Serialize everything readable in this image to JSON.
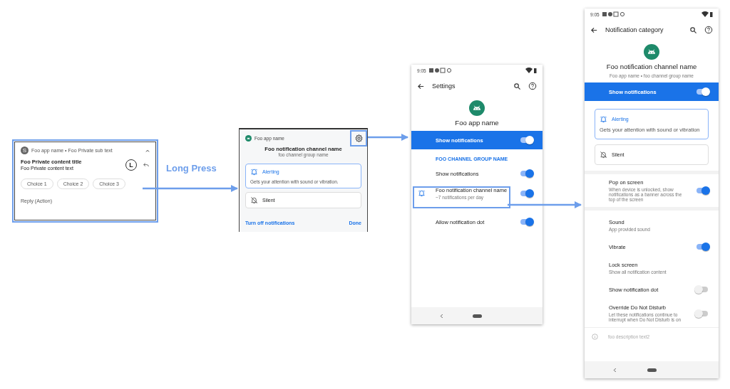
{
  "notification": {
    "app_badge": "S",
    "header": "Foo app name • Foo Private sub text",
    "title": "Foo Private content title",
    "text": "Foo Private content text",
    "large_icon": "L",
    "choices": [
      "Choice 1",
      "Choice 2",
      "Choice 3"
    ],
    "action": "Reply (Action)"
  },
  "gesture_label": "Long Press",
  "channel_dialog": {
    "app_name": "Foo app name",
    "channel_name": "Foo notification channel name",
    "group_name": "foo channel group name",
    "options": [
      {
        "kind": "alerting",
        "label": "Alerting",
        "description": "Gets your attention with sound or vibration.",
        "selected": true
      },
      {
        "kind": "silent",
        "label": "Silent",
        "selected": false
      }
    ],
    "turn_off": "Turn off notifications",
    "done": "Done"
  },
  "app_settings": {
    "time": "9:05",
    "title": "Settings",
    "app_name": "Foo app name",
    "master": {
      "label": "Show notifications",
      "on": true
    },
    "group_header": "FOO CHANNEL GROUP NAME",
    "rows": [
      {
        "kind": "switch",
        "label": "Show notifications",
        "on": true
      },
      {
        "kind": "channel",
        "label": "Foo notification channel name",
        "summary": "~7 notifications per day",
        "on": true
      },
      {
        "kind": "switch",
        "label": "Allow notification dot",
        "on": true
      }
    ]
  },
  "channel_settings": {
    "time": "9:05",
    "title": "Notification category",
    "channel_name": "Foo notification channel name",
    "subtitle": "Foo app name • foo channel group name",
    "master": {
      "label": "Show notifications",
      "on": true
    },
    "options": [
      {
        "kind": "alerting",
        "label": "Alerting",
        "description": "Gets your attention with sound or vibration",
        "selected": true
      },
      {
        "kind": "silent",
        "label": "Silent",
        "selected": false
      }
    ],
    "rows": [
      {
        "kind": "switch",
        "label": "Pop on screen",
        "summary": "When device is unlocked, show notifications as a banner across the top of the screen",
        "on": true
      },
      {
        "kind": "text",
        "label": "Sound",
        "summary": "App provided sound"
      },
      {
        "kind": "switch",
        "label": "Vibrate",
        "on": true
      },
      {
        "kind": "text",
        "label": "Lock screen",
        "summary": "Show all notification content"
      },
      {
        "kind": "switch",
        "label": "Show notification dot",
        "on": false
      },
      {
        "kind": "switch",
        "label": "Override Do Not Disturb",
        "summary": "Let these notifications continue to interrupt when Do Not Disturb is on",
        "on": false
      }
    ],
    "footer": "foo description text2"
  }
}
